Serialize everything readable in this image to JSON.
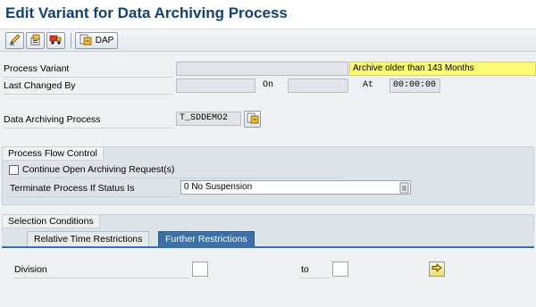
{
  "window": {
    "title": "Edit Variant for Data Archiving Process"
  },
  "toolbar": {
    "buttons": [
      {
        "icon": "edit-pencil-icon"
      },
      {
        "icon": "save-variant-icon"
      },
      {
        "icon": "transport-truck-icon"
      }
    ],
    "dap_label": "DAP",
    "dap_icon": "dap-object-icon"
  },
  "header_fields": {
    "process_variant_label": "Process Variant",
    "process_variant_value": "",
    "process_variant_desc": "Archive  older than 143 Months",
    "last_changed_by_label": "Last Changed By",
    "last_changed_by_value": "",
    "on_label": "On",
    "on_value": "",
    "at_label": "At",
    "at_value": "00:00:00",
    "dap_label": "Data Archiving Process",
    "dap_value": "T_SDDEMO2"
  },
  "process_flow": {
    "title": "Process Flow Control",
    "continue_label": "Continue Open Archiving Request(s)",
    "continue_checked": false,
    "terminate_label": "Terminate Process If Status Is",
    "terminate_value": "0 No Suspension"
  },
  "selection": {
    "title": "Selection Conditions",
    "tabs": [
      {
        "label": "Relative Time Restrictions",
        "active": false
      },
      {
        "label": "Further Restrictions",
        "active": true
      }
    ],
    "division_label": "Division",
    "division_from": "",
    "to_label": "to",
    "division_to": ""
  },
  "colors": {
    "title": "#13416d",
    "active_tab": "#3b6fa5",
    "highlight_field": "#fdfa7a"
  }
}
